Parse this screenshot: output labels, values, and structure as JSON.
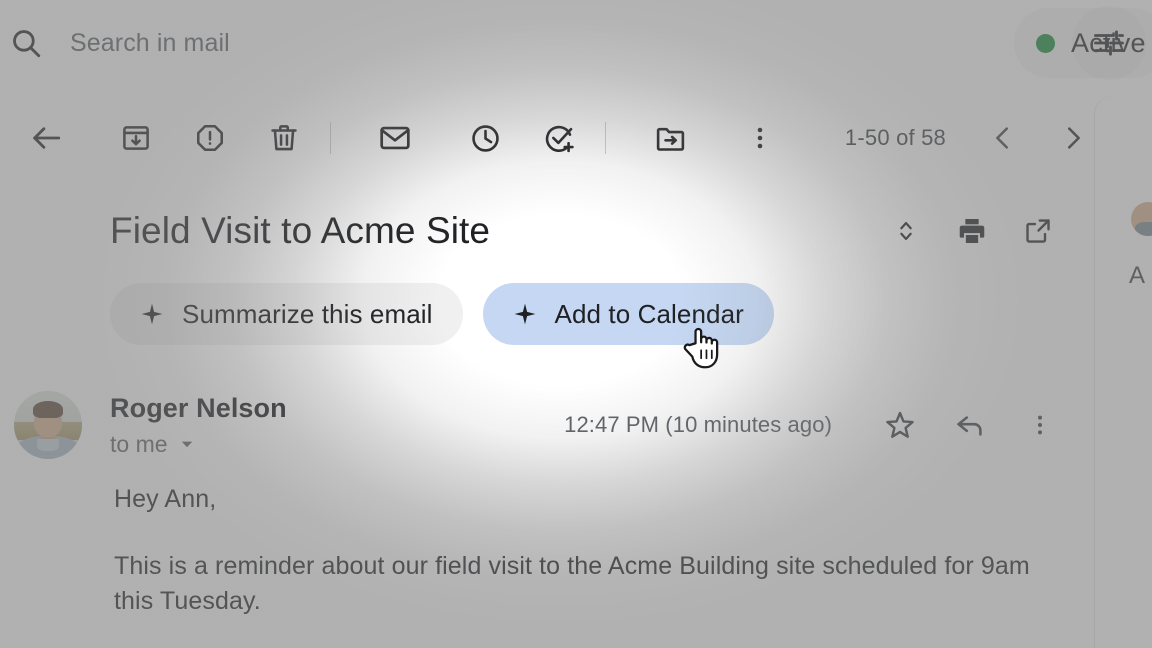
{
  "search": {
    "icon": "search-icon",
    "placeholder": "Search in mail",
    "value": "",
    "filter_icon": "tune-filter-icon"
  },
  "status": {
    "label": "Active",
    "dot_color": "#128a36"
  },
  "toolbar": {
    "back_icon": "back-arrow-icon",
    "archive_icon": "archive-icon",
    "spam_icon": "report-spam-icon",
    "delete_icon": "trash-icon",
    "unread_icon": "mark-unread-envelope-icon",
    "snooze_icon": "clock-snooze-icon",
    "tasks_icon": "add-to-tasks-icon",
    "move_icon": "move-to-folder-icon",
    "more_icon": "more-vertical-icon",
    "pager_count": "1-50 of 58",
    "prev_icon": "chevron-left-icon",
    "next_icon": "chevron-right-icon"
  },
  "subject": {
    "title": "Field Visit to Acme Site",
    "expand_icon": "expand-collapse-icon",
    "print_icon": "print-icon",
    "popout_icon": "open-in-new-icon"
  },
  "chips": [
    {
      "label": "Summarize this email",
      "icon": "sparkle-icon",
      "name": "chip-summarize-this-email",
      "style": "chip-summarize",
      "highlighted": false
    },
    {
      "label": "Add to Calendar",
      "icon": "sparkle-icon",
      "name": "chip-add-to-calendar",
      "style": "chip-calendar",
      "highlighted": true,
      "background": "#c5d7f2"
    }
  ],
  "message": {
    "sender_name": "Roger Nelson",
    "recipient": "to me",
    "recipient_caret": "caret-down-icon",
    "timestamp": "12:47 PM (10 minutes ago)",
    "star_icon": "star-outline-icon",
    "reply_icon": "reply-arrow-icon",
    "more_icon": "more-vertical-icon",
    "avatar": "sender-avatar-photo",
    "body_lines": [
      "Hey Ann,",
      "This is a reminder about our field visit to the Acme Building site scheduled for 9am this Tuesday."
    ]
  },
  "side_panel": {
    "letter": "A"
  },
  "cursor": {
    "type": "pointing-hand-cursor"
  }
}
